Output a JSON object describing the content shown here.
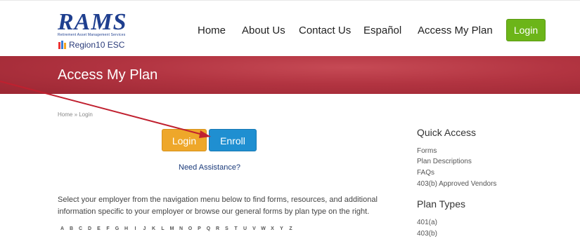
{
  "logo": {
    "name": "RAMS",
    "tagline": "Retirement Asset Management Services",
    "region": "Region10 ESC"
  },
  "nav": {
    "items": [
      "Home",
      "About Us",
      "Contact Us",
      "Español",
      "Access My Plan"
    ],
    "login": "Login"
  },
  "banner": {
    "title": "Access My Plan"
  },
  "breadcrumb": "Home » Login",
  "actions": {
    "login": "Login",
    "enroll": "Enroll",
    "assistance": "Need Assistance?"
  },
  "intro": "Select your employer from the navigation menu below to find forms, resources, and additional information specific to your employer or browse our general forms by plan type on the right.",
  "alphabet": [
    "A",
    "B",
    "C",
    "D",
    "E",
    "F",
    "G",
    "H",
    "I",
    "J",
    "K",
    "L",
    "M",
    "N",
    "O",
    "P",
    "Q",
    "R",
    "S",
    "T",
    "U",
    "V",
    "W",
    "X",
    "Y",
    "Z"
  ],
  "sidebar": {
    "quick_access": {
      "title": "Quick Access",
      "links": [
        "Forms",
        "Plan Descriptions",
        "FAQs",
        "403(b) Approved Vendors"
      ]
    },
    "plan_types": {
      "title": "Plan Types",
      "links": [
        "401(a)",
        "403(b)"
      ]
    }
  },
  "colors": {
    "brand_blue": "#1f3f8f",
    "banner_red": "#b23441",
    "login_green": "#6cb519",
    "login_orange": "#eea72a",
    "enroll_blue": "#1f8fd1",
    "annotation": "#c0202f"
  }
}
